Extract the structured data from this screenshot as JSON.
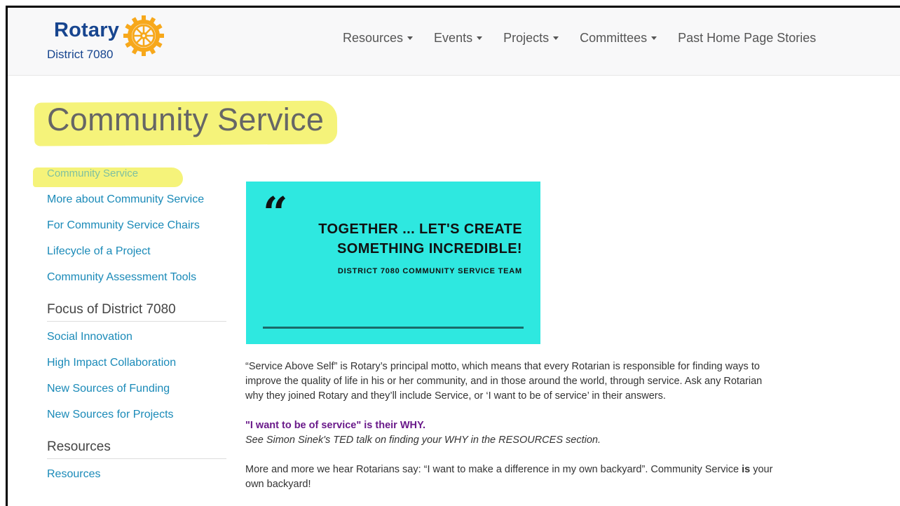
{
  "logo": {
    "word": "Rotary",
    "district": "District 7080",
    "wheel_color": "#f7a81b",
    "brand_color": "#17458f"
  },
  "nav": {
    "items": [
      {
        "label": "Resources",
        "dropdown": true
      },
      {
        "label": "Events",
        "dropdown": true
      },
      {
        "label": "Projects",
        "dropdown": true
      },
      {
        "label": "Committees",
        "dropdown": true
      },
      {
        "label": "Past Home Page Stories",
        "dropdown": false
      }
    ]
  },
  "page": {
    "title": "Community Service",
    "highlight_color": "#f5f37a"
  },
  "sidebar": {
    "links": [
      {
        "label": "Community Service",
        "active": true
      },
      {
        "label": "More about Community Service"
      },
      {
        "label": "For Community Service Chairs"
      },
      {
        "label": "Lifecycle of a Project"
      },
      {
        "label": "Community Assessment Tools"
      }
    ],
    "focus_heading": "Focus of District 7080",
    "focus_links": [
      {
        "label": "Social Innovation"
      },
      {
        "label": "High Impact Collaboration"
      },
      {
        "label": "New Sources of Funding"
      },
      {
        "label": "New Sources for Projects"
      }
    ],
    "resources_heading": "Resources",
    "resources_links": [
      {
        "label": "Resources"
      }
    ]
  },
  "banner": {
    "quote": "“",
    "line1": "TOGETHER ... LET'S CREATE",
    "line2": "SOMETHING INCREDIBLE!",
    "team": "DISTRICT 7080 COMMUNITY SERVICE TEAM",
    "bg_color": "#2ee8e0"
  },
  "content": {
    "para1_line1": "“Service Above Self” is Rotary’s principal motto, which means that every Rotarian is responsible for finding ways to",
    "para1_line2": "improve the quality of life in his or her community, and in those around the world, through service. Ask any Rotarian",
    "para1_line3": "why they joined Rotary and they’ll include Service, or ‘I want to be of service’ in their answers.",
    "why_bold": "\"I want to be of service\" is their WHY.",
    "why_italic": "See Simon Sinek's TED talk on finding your WHY in the RESOURCES section.",
    "para3_line1_a": "More and more we hear Rotarians say: “I want to make a difference in my own backyard”. Community Service ",
    "para3_line1_bold": "is",
    "para3_line1_b": " your",
    "para3_line2": "own backyard!"
  }
}
